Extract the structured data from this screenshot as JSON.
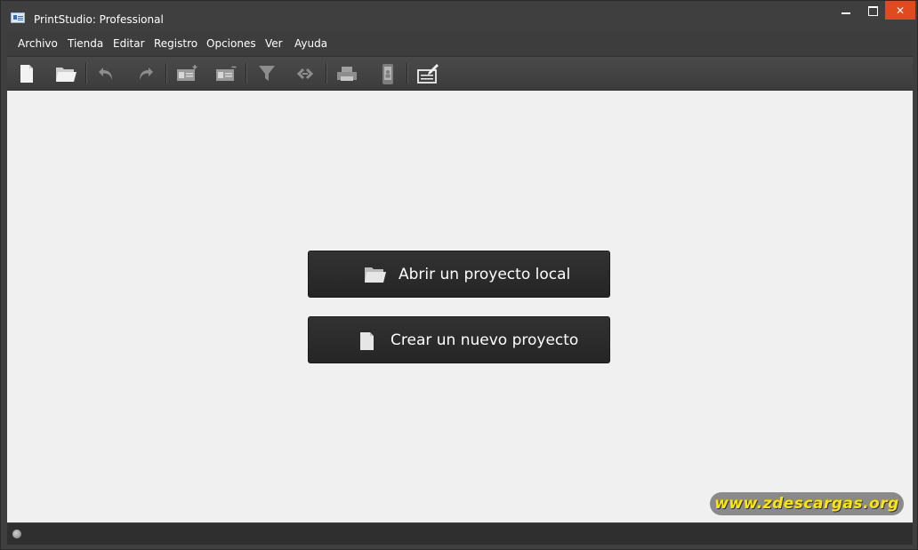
{
  "window": {
    "title": "PrintStudio: Professional",
    "close_symbol": "✕"
  },
  "menu": {
    "items": [
      "Archivo",
      "Tienda",
      "Editar",
      "Registro",
      "Opciones",
      "Ver",
      "Ayuda"
    ]
  },
  "toolbar": {
    "icons": [
      "new-document-icon",
      "open-folder-icon",
      "undo-icon",
      "redo-icon",
      "add-card-icon",
      "remove-card-icon",
      "filter-icon",
      "link-icon",
      "print-icon",
      "mobile-device-icon",
      "edit-card-icon"
    ]
  },
  "main": {
    "open_project_label": "Abrir un proyecto local",
    "new_project_label": "Crear un nuevo proyecto"
  },
  "watermark": {
    "text": "www.zdescargas.org"
  },
  "colors": {
    "close_button": "#e04a1e",
    "watermark_text": "#ffe600",
    "canvas": "#f0f0f0",
    "action_button": "#2b2b2b"
  }
}
